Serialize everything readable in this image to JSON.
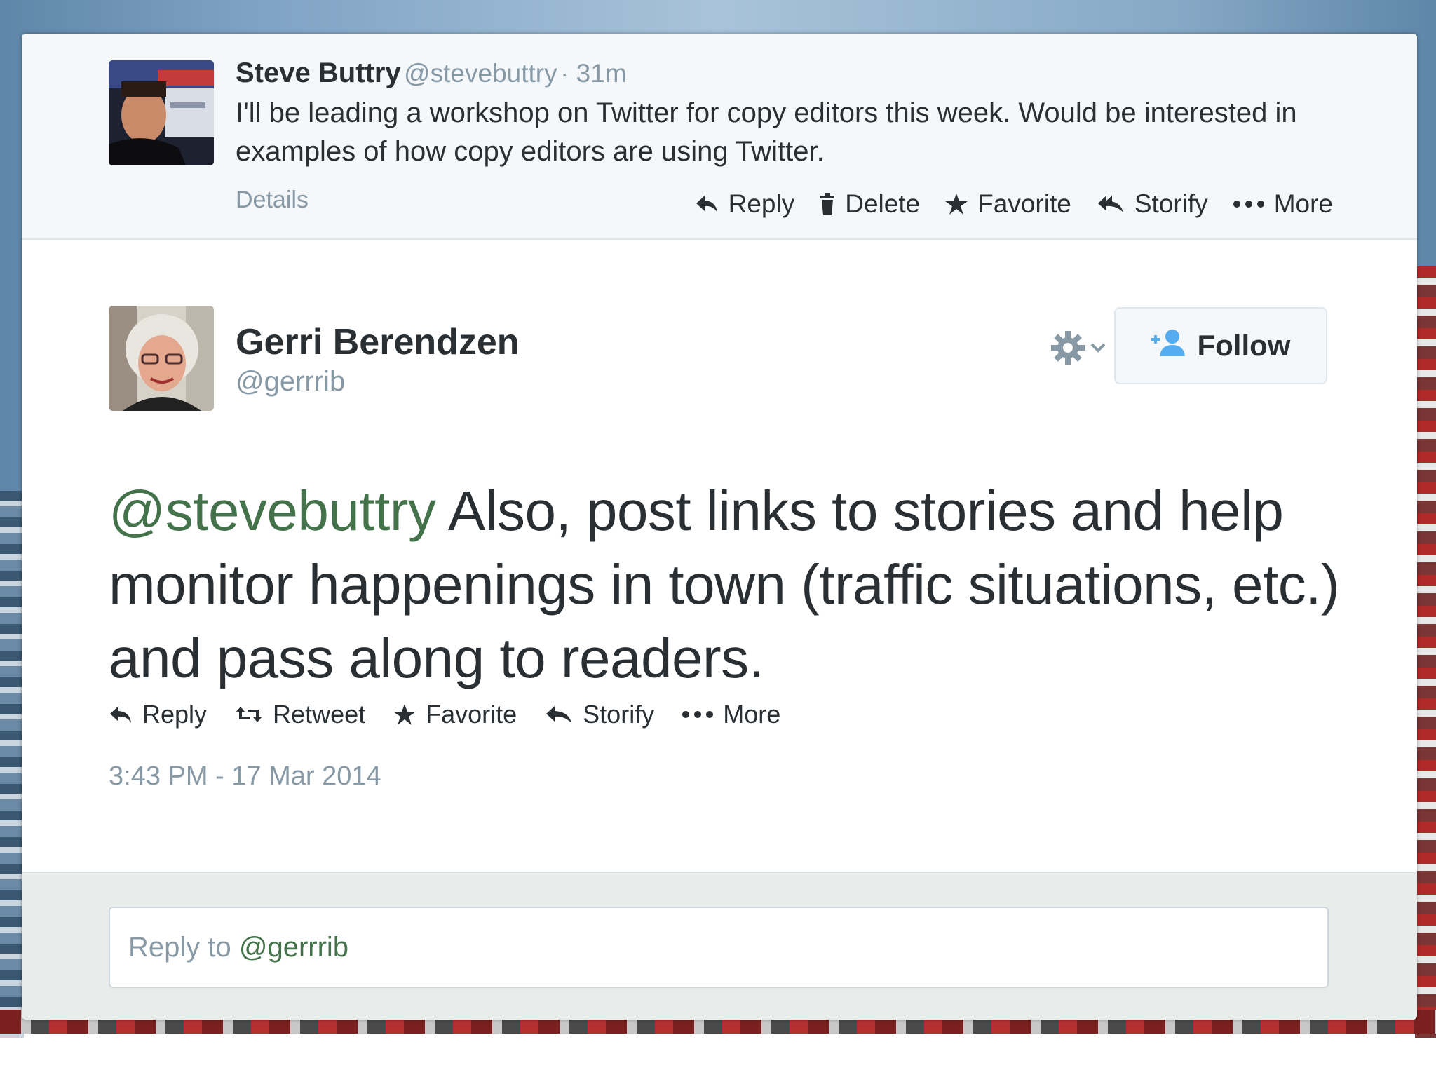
{
  "parent_tweet": {
    "name": "Steve Buttry",
    "handle": "@stevebuttry",
    "time": "· 31m",
    "text": "I'll be leading a workshop on Twitter for copy editors this week. Would be interested in examples of how copy editors are using Twitter.",
    "details_label": "Details",
    "actions": [
      {
        "icon": "reply-icon",
        "label": "Reply"
      },
      {
        "icon": "trash-icon",
        "label": "Delete"
      },
      {
        "icon": "star-icon",
        "label": "Favorite"
      },
      {
        "icon": "storify-icon",
        "label": "Storify"
      },
      {
        "icon": "ellipsis-icon",
        "label": "More"
      }
    ]
  },
  "tweet": {
    "name": "Gerri Berendzen",
    "handle": "@gerrrib",
    "mention": "@stevebuttry",
    "text": " Also,  post links to stories and help monitor happenings in town (traffic situations, etc.) and pass along to readers.",
    "follow_label": "Follow",
    "actions": [
      {
        "icon": "reply-icon",
        "label": "Reply"
      },
      {
        "icon": "retweet-icon",
        "label": "Retweet"
      },
      {
        "icon": "star-icon",
        "label": "Favorite"
      },
      {
        "icon": "storify-icon",
        "label": "Storify"
      },
      {
        "icon": "ellipsis-icon",
        "label": "More"
      }
    ],
    "timestamp": "3:43 PM - 17 Mar 2014"
  },
  "reply_box": {
    "prefix": "Reply to ",
    "mention": "@gerrrib"
  },
  "colors": {
    "text": "#292f33",
    "muted": "#8899a6",
    "mention": "#43724b",
    "follow_icon": "#55acee"
  }
}
